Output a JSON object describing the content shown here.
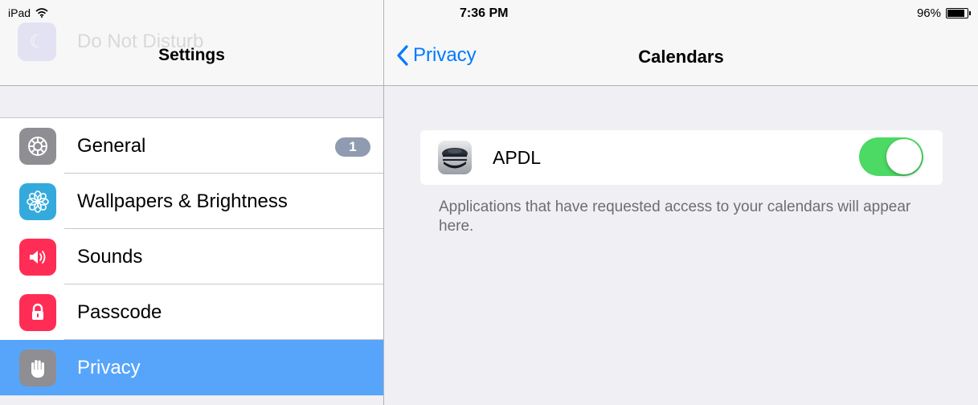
{
  "status_bar": {
    "device": "iPad",
    "time": "7:36 PM",
    "battery": "96%",
    "battery_level": 0.96,
    "icons": [
      "wifi-icon",
      "battery-icon"
    ]
  },
  "sidebar": {
    "ghost_item": "Do Not Disturb",
    "title": "Settings",
    "items": [
      {
        "label": "General",
        "icon": "gear-icon",
        "badge": "1",
        "icon_color": "#8e8e93"
      },
      {
        "label": "Wallpapers & Brightness",
        "icon": "flower-icon",
        "icon_color": "#34aadc"
      },
      {
        "label": "Sounds",
        "icon": "speaker-icon",
        "icon_color": "#ff2d55"
      },
      {
        "label": "Passcode",
        "icon": "lock-icon",
        "icon_color": "#ff2d55"
      },
      {
        "label": "Privacy",
        "icon": "hand-icon",
        "icon_color": "#8e8e93",
        "selected": true
      }
    ]
  },
  "detail": {
    "back_label": "Privacy",
    "title": "Calendars",
    "apps": [
      {
        "name": "APDL",
        "icon": "pilot-cap-icon",
        "enabled": true
      }
    ],
    "footer": "Applications that have requested access to your calendars will appear here."
  },
  "colors": {
    "accent": "#007aff",
    "selection": "#57a5fb",
    "toggle_on": "#4cd964",
    "badge": "#8e9bb0",
    "background": "#efeff4"
  }
}
